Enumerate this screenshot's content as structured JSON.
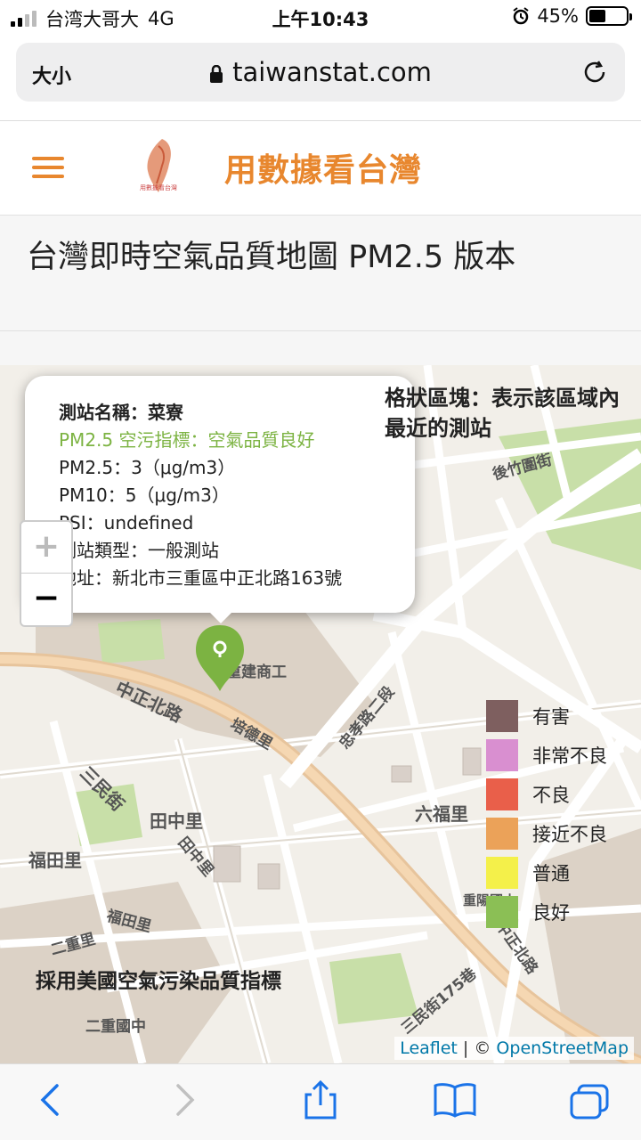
{
  "status_bar": {
    "carrier": "台湾大哥大",
    "network": "4G",
    "time": "上午10:43",
    "battery": "45%",
    "battery_level": 0.45
  },
  "browser": {
    "text_size_label": "大小",
    "url": "taiwanstat.com"
  },
  "site": {
    "logo_text": "用數據看台灣",
    "title": "用數據看台灣"
  },
  "page": {
    "title": "台灣即時空氣品質地圖 PM2.5 版本"
  },
  "map": {
    "zoom_in": "+",
    "zoom_out": "−",
    "grid_note": "格狀區塊：表示該區域內最近的測站",
    "aqi_note": "採用美國空氣污染品質指標",
    "attribution": {
      "leaflet": "Leaflet",
      "sep": " | © ",
      "osm": "OpenStreetMap"
    },
    "popup": {
      "station_name": "測站名稱：菜寮",
      "status": "PM2.5 空污指標：空氣品質良好",
      "pm25": "PM2.5：3（μg/m3）",
      "pm10": "PM10：5（μg/m3）",
      "psi": "PSI：undefined",
      "station_type": "測站類型：一般測站",
      "address": "地址：新北市三重區中正北路163號"
    },
    "labels": {
      "l1": "中正北路",
      "l2": "三民街",
      "l3": "田中里",
      "l4": "福田里",
      "l5": "六福里",
      "l6": "培德里",
      "l7": "忠孝路二段",
      "l8": "後竹圍街",
      "l9": "二重里",
      "l10": "重陽國小",
      "l11": "二重國中",
      "l12": "三民街175巷",
      "l13": "中正北路",
      "l14": "福田里",
      "l15": "田中里",
      "l16": "重建商工"
    },
    "legend": [
      {
        "label": "有害",
        "color": "#7e5f5f"
      },
      {
        "label": "非常不良",
        "color": "#d98fd0"
      },
      {
        "label": "不良",
        "color": "#e95f4a"
      },
      {
        "label": "接近不良",
        "color": "#eba259"
      },
      {
        "label": "普通",
        "color": "#f4f04a"
      },
      {
        "label": "良好",
        "color": "#8bbf55"
      }
    ]
  },
  "colors": {
    "accent": "#e8872e",
    "good": "#7cb342",
    "link": "#0078a8"
  }
}
